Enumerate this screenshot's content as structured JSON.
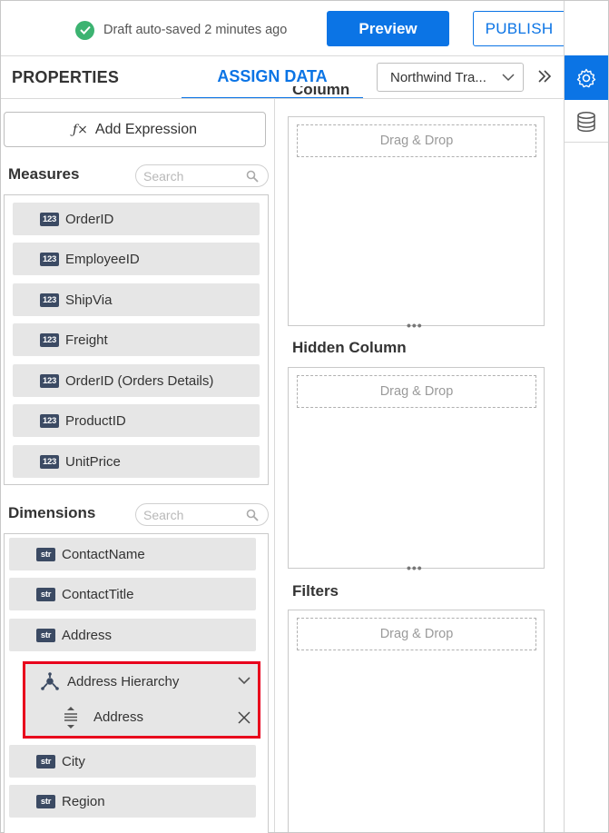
{
  "topbar": {
    "save_status": "Draft auto-saved 2 minutes ago",
    "preview_label": "Preview",
    "publish_label": "PUBLISH"
  },
  "tabs": {
    "properties": "PROPERTIES",
    "assign_data": "ASSIGN DATA"
  },
  "datasource": {
    "selected": "Northwind Tra..."
  },
  "left": {
    "add_expression": "Add Expression",
    "measures_title": "Measures",
    "measures_search_placeholder": "Search",
    "measures": [
      {
        "badge": "123",
        "label": "OrderID"
      },
      {
        "badge": "123",
        "label": "EmployeeID"
      },
      {
        "badge": "123",
        "label": "ShipVia"
      },
      {
        "badge": "123",
        "label": "Freight"
      },
      {
        "badge": "123",
        "label": "OrderID (Orders Details)"
      },
      {
        "badge": "123",
        "label": "ProductID"
      },
      {
        "badge": "123",
        "label": "UnitPrice"
      }
    ],
    "dimensions_title": "Dimensions",
    "dimensions_search_placeholder": "Search",
    "dimensions": [
      {
        "badge": "str",
        "label": "ContactName"
      },
      {
        "badge": "str",
        "label": "ContactTitle"
      },
      {
        "badge": "str",
        "label": "Address"
      }
    ],
    "hierarchy": {
      "label": "Address Hierarchy",
      "child": "Address"
    },
    "dimensions_after": [
      {
        "badge": "str",
        "label": "City"
      },
      {
        "badge": "str",
        "label": "Region"
      }
    ]
  },
  "middle": {
    "column_title": "Column",
    "column_drop": "Drag & Drop",
    "hidden_title": "Hidden Column",
    "hidden_drop": "Drag & Drop",
    "filters_title": "Filters",
    "filters_drop": "Drag & Drop"
  },
  "colors": {
    "accent": "#0b74e5",
    "highlight_border": "#e8001c",
    "badge_bg": "#3b4a63",
    "success": "#3cb371"
  }
}
